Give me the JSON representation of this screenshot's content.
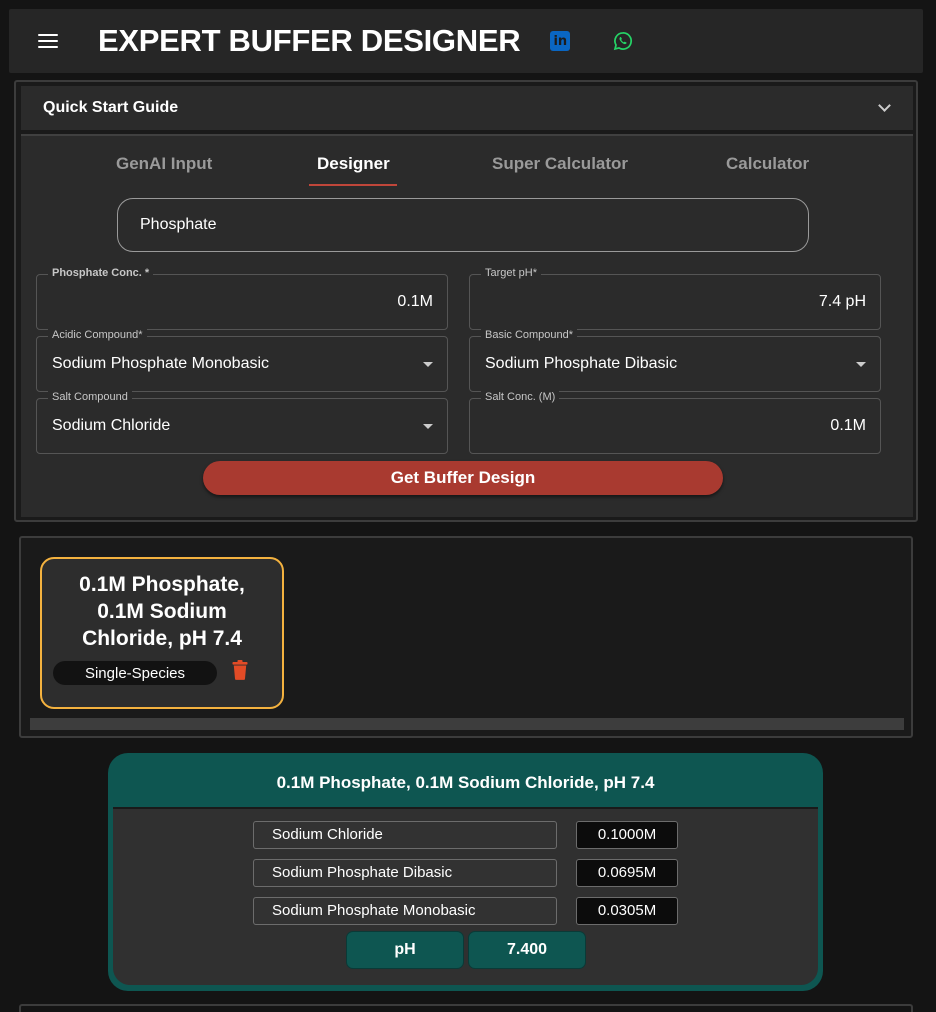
{
  "app": {
    "title": "EXPERT BUFFER DESIGNER",
    "icons": {
      "menu": "menu-icon",
      "linkedin": "linkedin-icon",
      "linkedin_text": "in",
      "whatsapp": "whatsapp-icon"
    },
    "colors": {
      "linkedin": "#0a66c2",
      "whatsapp": "#25d366",
      "accent_red": "#a93a30",
      "card_border": "#f4b23f",
      "result_teal": "#0e5651"
    }
  },
  "quick_start": {
    "label": "Quick Start Guide"
  },
  "tabs": [
    {
      "label": "GenAI Input",
      "active": false
    },
    {
      "label": "Designer",
      "active": true
    },
    {
      "label": "Super Calculator",
      "active": false
    },
    {
      "label": "Calculator",
      "active": false
    }
  ],
  "designer": {
    "buffer_search": {
      "value": "Phosphate"
    },
    "fields": {
      "phosphate_conc": {
        "label": "Phosphate Conc. *",
        "value": "0.1M"
      },
      "target_ph": {
        "label": "Target pH*",
        "value": "7.4 pH"
      },
      "acidic_compound": {
        "label": "Acidic Compound*",
        "value": "Sodium Phosphate Monobasic"
      },
      "basic_compound": {
        "label": "Basic Compound*",
        "value": "Sodium Phosphate Dibasic"
      },
      "salt_compound": {
        "label": "Salt Compound",
        "value": "Sodium Chloride"
      },
      "salt_conc": {
        "label": "Salt Conc. (M)",
        "value": "0.1M"
      }
    },
    "submit_label": "Get Buffer Design"
  },
  "saved_designs": [
    {
      "title": "0.1M Phosphate, 0.1M Sodium Chloride, pH 7.4",
      "badge": "Single-Species",
      "delete_icon": "trash-icon"
    }
  ],
  "result": {
    "title": "0.1M Phosphate, 0.1M Sodium Chloride, pH 7.4",
    "components": [
      {
        "name": "Sodium Chloride",
        "conc": "0.1000M"
      },
      {
        "name": "Sodium Phosphate Dibasic",
        "conc": "0.0695M"
      },
      {
        "name": "Sodium Phosphate Monobasic",
        "conc": "0.0305M"
      }
    ],
    "ph_label": "pH",
    "ph_value": "7.400"
  }
}
